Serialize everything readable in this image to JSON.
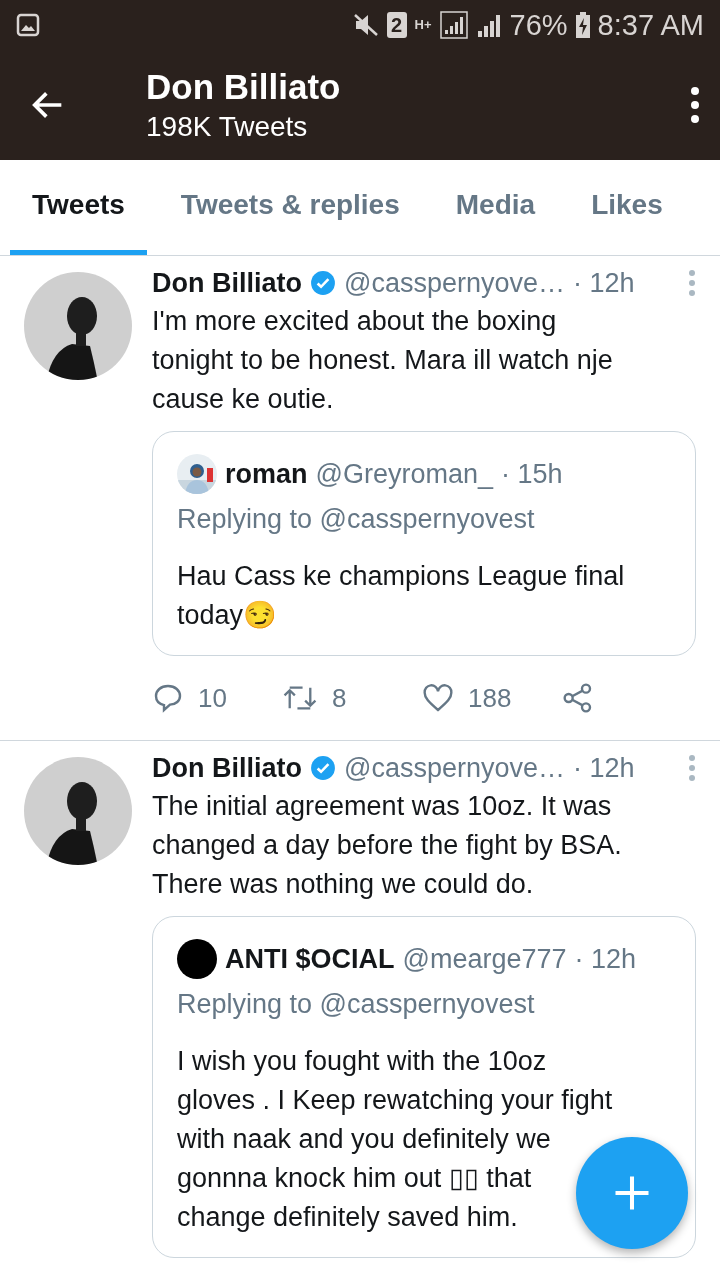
{
  "status_bar": {
    "sim_slot": "2",
    "network": "H+",
    "battery": "76%",
    "time": "8:37 AM"
  },
  "header": {
    "title": "Don Billiato",
    "subtitle": "198K Tweets"
  },
  "tabs": [
    {
      "label": "Tweets",
      "selected": true
    },
    {
      "label": "Tweets & replies",
      "selected": false
    },
    {
      "label": "Media",
      "selected": false
    },
    {
      "label": "Likes",
      "selected": false
    }
  ],
  "tweets": [
    {
      "author": "Don Billiato",
      "verified": true,
      "handle": "@casspernyove…",
      "time": "· 12h",
      "text_lines": [
        "I'm more excited about the boxing",
        "tonight to be honest. Mara ill watch nje",
        "cause ke outie."
      ],
      "quote": {
        "name": "roman",
        "handle": "@Greyroman_",
        "time": "· 15h",
        "replying_to": "Replying to @casspernyovest",
        "text_lines": [
          "Hau Cass ke champions League final",
          "today😏"
        ]
      },
      "actions": {
        "replies": "10",
        "retweets": "8",
        "likes": "188"
      }
    },
    {
      "author": "Don Billiato",
      "verified": true,
      "handle": "@casspernyove…",
      "time": "· 12h",
      "text_lines": [
        "The initial agreement was 10oz. It was",
        "changed a day before the fight by BSA.",
        "There was nothing we could do."
      ],
      "quote": {
        "kind": "plain",
        "name": "ANTI $OCIAL",
        "handle": "@mearge777",
        "time": "· 12h",
        "replying_to": "Replying to @casspernyovest",
        "text_lines": [
          "I wish you fought with the 10oz",
          "gloves . I Keep rewatching your fight",
          "with naak and you definitely we",
          "gonnna knock him out  ▯▯ that",
          "change definitely saved him."
        ]
      }
    }
  ]
}
